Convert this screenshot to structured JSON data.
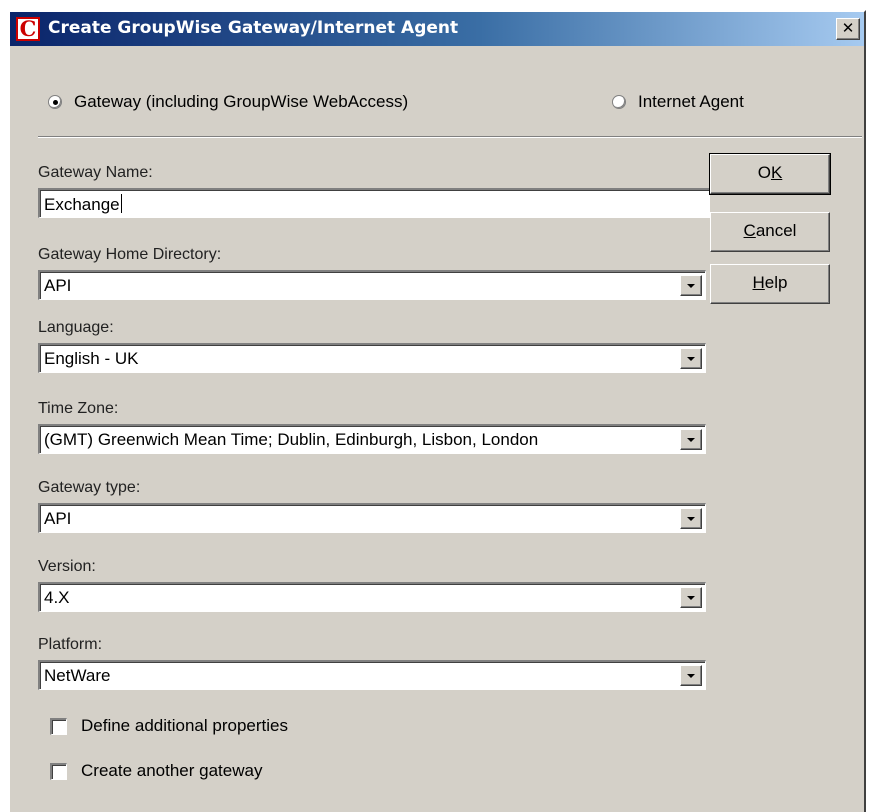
{
  "window": {
    "title": "Create GroupWise Gateway/Internet Agent",
    "icon_letter": "C",
    "close_glyph": "✕",
    "icon_name": "app-c-icon"
  },
  "mode": {
    "gateway_label": "Gateway (including GroupWise WebAccess)",
    "internet_agent_label": "Internet Agent",
    "selected": "gateway"
  },
  "fields": {
    "gateway_name": {
      "label": "Gateway Name:",
      "value": "Exchange"
    },
    "home_directory": {
      "label": "Gateway Home Directory:",
      "value": "API"
    },
    "language": {
      "label": "Language:",
      "value": "English - UK"
    },
    "time_zone": {
      "label": "Time Zone:",
      "value": "(GMT) Greenwich Mean Time; Dublin, Edinburgh, Lisbon, London"
    },
    "gateway_type": {
      "label": "Gateway type:",
      "value": "API"
    },
    "version": {
      "label": "Version:",
      "value": "4.X"
    },
    "platform": {
      "label": "Platform:",
      "value": "NetWare"
    }
  },
  "buttons": {
    "ok": {
      "pre": "O",
      "mnemonic": "K",
      "post": ""
    },
    "cancel": {
      "pre": "",
      "mnemonic": "C",
      "post": "ancel"
    },
    "help": {
      "pre": "",
      "mnemonic": "H",
      "post": "elp"
    }
  },
  "options": {
    "define_additional": {
      "label": "Define additional properties",
      "checked": false
    },
    "create_another": {
      "label": "Create another gateway",
      "checked": false
    }
  },
  "colors": {
    "dialog_face": "#d4d0c8",
    "titlebar_start": "#0a246a",
    "titlebar_end": "#a6caf0",
    "icon_red": "#cc0000"
  }
}
